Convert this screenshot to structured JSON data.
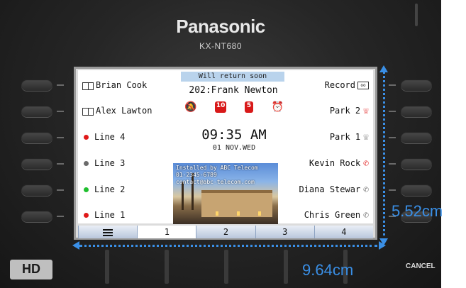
{
  "device": {
    "brand": "Panasonic",
    "model": "KX-NT680",
    "logo_badge": "HD",
    "cancel_label": "CANCEL"
  },
  "status_bar": {
    "message": "Will return soon",
    "extension": "202:Frank Newton"
  },
  "clock": {
    "time": "09:35 AM",
    "date": "01 NOV.WED"
  },
  "left_keys": [
    {
      "label": "Brian Cook",
      "icon": "phonebook-icon"
    },
    {
      "label": "Alex Lawton",
      "icon": "phonebook-icon"
    },
    {
      "label": "Line 4",
      "indicator_color": "#e01919"
    },
    {
      "label": "Line 3",
      "indicator_color": "#6b6b6b"
    },
    {
      "label": "Line 2",
      "indicator_color": "#1fbf2e"
    },
    {
      "label": "Line 1",
      "indicator_color": "#e01919"
    }
  ],
  "right_keys": [
    {
      "label": "Record",
      "icon": "voicemail-icon"
    },
    {
      "label": "Park 2",
      "icon": "park-icon",
      "color": "#e01919"
    },
    {
      "label": "Park 1",
      "icon": "park-icon",
      "color": "#6b6b6b"
    },
    {
      "label": "Kevin Rock",
      "icon": "phone-icon",
      "color": "#e01919"
    },
    {
      "label": "Diana Stewar",
      "icon": "phone-icon",
      "color": "#6b6b6b"
    },
    {
      "label": "Chris Green",
      "icon": "phone-icon",
      "color": "#6b6b6b"
    }
  ],
  "status_icons": [
    {
      "name": "mute-bell-icon",
      "glyph": "🔕"
    },
    {
      "name": "missed-calls-icon",
      "glyph": "10"
    },
    {
      "name": "messages-icon",
      "glyph": "5"
    },
    {
      "name": "alarm-icon",
      "glyph": "⏰"
    }
  ],
  "banner": {
    "line1": "Installed by ABC Telecom",
    "line2": "01-2345-6789",
    "line3": "contact@abc-telecom.com"
  },
  "tabs": [
    {
      "label": "",
      "icon": "menu-icon"
    },
    {
      "label": "1"
    },
    {
      "label": "2"
    },
    {
      "label": "3"
    },
    {
      "label": "4"
    }
  ],
  "dimensions": {
    "height_label": "5.52cm",
    "width_label": "9.64cm",
    "color": "#3a8fe6"
  }
}
